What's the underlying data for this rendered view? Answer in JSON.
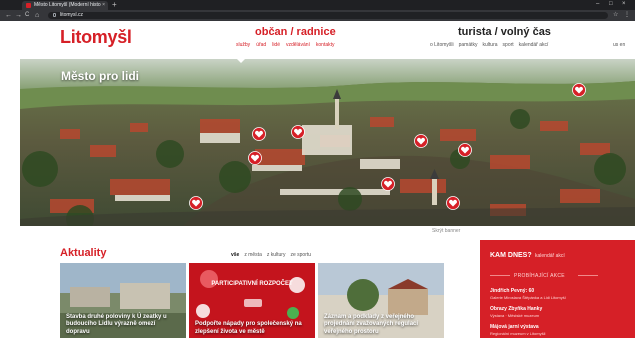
{
  "browser": {
    "tab_title": "Město Litomyšl (Moderní histo",
    "tab_close": "×",
    "new_tab": "+",
    "url": "litomysl.cz",
    "win_min": "–",
    "win_max": "□",
    "win_close": "×",
    "back_glyph": "←",
    "forward_glyph": "→",
    "reload_glyph": "C",
    "home_glyph": "⌂",
    "star_glyph": "☆",
    "menu_glyph": "⋮"
  },
  "header": {
    "logo": "Litomyšl",
    "citizen": {
      "title": "občan / radnice",
      "links": [
        "služby",
        "úřad",
        "lidé",
        "vzdělávání",
        "kontakty"
      ]
    },
    "tourist": {
      "title": "turista / volný čas",
      "links": [
        "o Litomyšli",
        "památky",
        "kultura",
        "sport",
        "kalendář akcí"
      ]
    },
    "language": "us  en"
  },
  "hero": {
    "title": "Město pro lidi",
    "hide_banner": "Skrýt banner"
  },
  "news": {
    "title": "Aktuality",
    "filters": [
      "vše",
      "z města",
      "z kultury",
      "ze sportu"
    ],
    "cards": [
      {
        "text": "Stavba druhé poloviny k Ú zeatky u budoucího Lidlu výrazně omezí dopravu"
      },
      {
        "header": "PARTICIPATIVNÍ ROZPOČET",
        "text": "Podpořte nápady pro společenský na zlepšení života ve městě"
      },
      {
        "text": "Záznam a podklady z veřejného projednání zvažovaných regulací veřejného prostoru"
      }
    ]
  },
  "events": {
    "title": "KAM DNES?",
    "calendar_link": "kalendář akcí",
    "subtitle": "PROBÍHAJÍCÍ AKCE",
    "items": [
      {
        "title": "Jindřich Pevný: 60",
        "sub": "Galerie Miroslava Štěpánka a Lidi Litomyšl"
      },
      {
        "title": "Obrazy Zbyňka Hanky",
        "sub": "Výstava · Městské muzeum"
      },
      {
        "title": "Májová jarní výstava",
        "sub": "Regionální muzeum v Litomyšli"
      }
    ]
  },
  "colors": {
    "brand_red": "#d62027",
    "chrome_dark": "#202124"
  }
}
